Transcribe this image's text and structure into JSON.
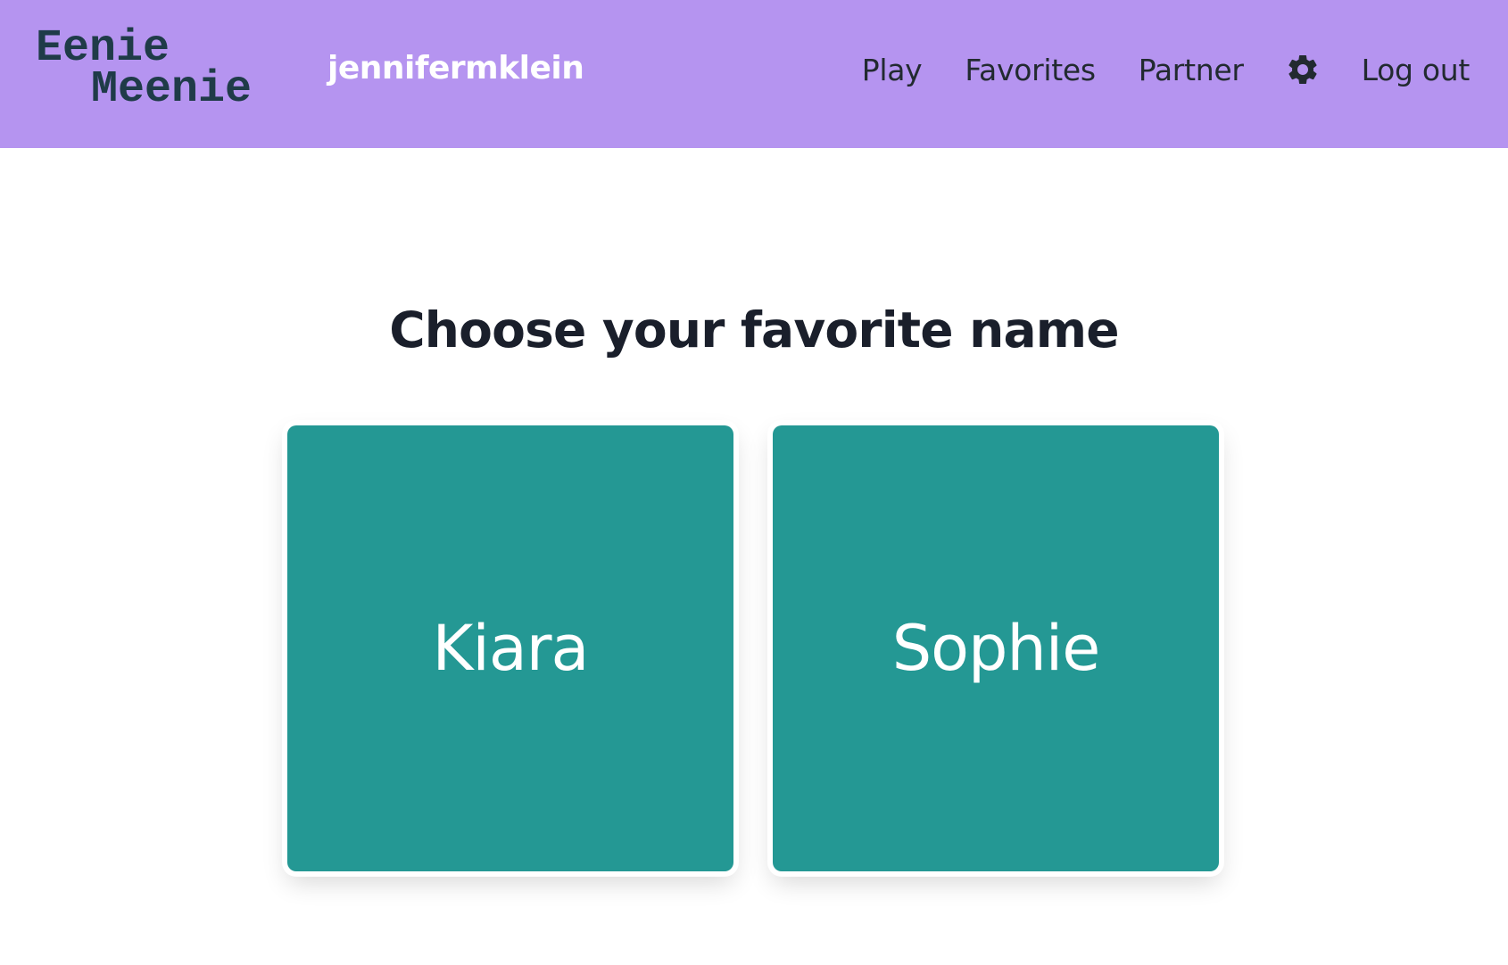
{
  "header": {
    "logo": {
      "line1": "Eenie",
      "line2": "Meenie"
    },
    "username": "jennifermklein",
    "nav": {
      "play": "Play",
      "favorites": "Favorites",
      "partner": "Partner",
      "settings_icon": "gear-icon",
      "logout": "Log out"
    },
    "colors": {
      "background": "#b594f0",
      "logo": "#1f3b48"
    }
  },
  "main": {
    "title": "Choose your favorite name",
    "choices": [
      {
        "name": "Kiara"
      },
      {
        "name": "Sophie"
      }
    ],
    "colors": {
      "card": "#249894",
      "card_text": "#ffffff"
    }
  }
}
